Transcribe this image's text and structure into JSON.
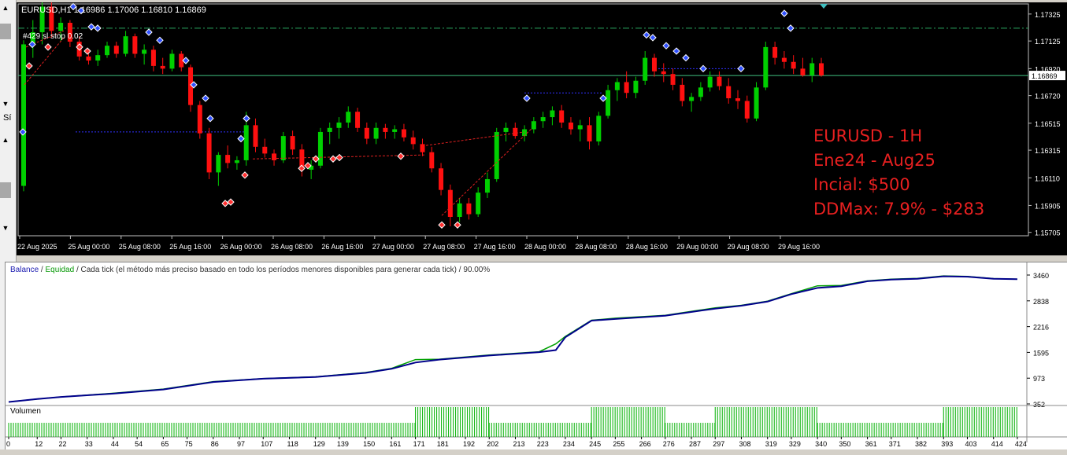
{
  "left_strip": {
    "text_1": "Sí"
  },
  "chart": {
    "symbol_header": "EURUSD,H1  1.16986 1.17006 1.16810 1.16869",
    "trade_label": "#429 sl stop 0.02",
    "current_price": "1.16869",
    "price_ticks": [
      "1.17325",
      "1.17125",
      "1.16920",
      "1.16720",
      "1.16515",
      "1.16315",
      "1.16110",
      "1.15905",
      "1.15705"
    ],
    "time_ticks": [
      "22 Aug 2025",
      "25 Aug 00:00",
      "25 Aug 08:00",
      "25 Aug 16:00",
      "26 Aug 00:00",
      "26 Aug 08:00",
      "26 Aug 16:00",
      "27 Aug 00:00",
      "27 Aug 08:00",
      "27 Aug 16:00",
      "28 Aug 00:00",
      "28 Aug 08:00",
      "28 Aug 16:00",
      "29 Aug 00:00",
      "29 Aug 08:00",
      "29 Aug 16:00"
    ],
    "colors": {
      "bull": "#00d000",
      "bear": "#ff1010",
      "background": "#000000",
      "grid_line": "#40c080",
      "trade_line": "#3030ff"
    },
    "overlay": [
      "EURUSD - 1H",
      "Ene24 - Aug25",
      "Incial: $500",
      "DDMax: 7.9% - $283"
    ]
  },
  "tester": {
    "legend_balance": "Balance",
    "legend_equity": "Equidad",
    "mode_text": " / Cada tick (el método más preciso basado en todo los períodos menores disponibles para generar cada tick)  / 90.00%",
    "y_ticks": [
      "3460",
      "2838",
      "2216",
      "1595",
      "973",
      "352"
    ],
    "volume_label": "Volumen",
    "x_ticks": [
      "0",
      "12",
      "22",
      "33",
      "44",
      "54",
      "65",
      "75",
      "86",
      "97",
      "107",
      "118",
      "129",
      "139",
      "150",
      "161",
      "171",
      "181",
      "192",
      "202",
      "213",
      "223",
      "234",
      "245",
      "255",
      "266",
      "276",
      "287",
      "297",
      "308",
      "319",
      "329",
      "340",
      "350",
      "361",
      "371",
      "382",
      "393",
      "403",
      "414",
      "424"
    ],
    "colors": {
      "balance": "#00008b",
      "equity": "#00a000",
      "volume": "#00b000"
    }
  },
  "chart_data": [
    {
      "type": "candlestick",
      "title": "EURUSD,H1",
      "ylim": [
        1.1568,
        1.174
      ],
      "candles": [
        [
          1.1605,
          1.1713,
          1.1601,
          1.171
        ],
        [
          1.171,
          1.1728,
          1.17,
          1.1719
        ],
        [
          1.1719,
          1.1745,
          1.171,
          1.1738
        ],
        [
          1.1738,
          1.1742,
          1.1715,
          1.172
        ],
        [
          1.172,
          1.173,
          1.1712,
          1.1726
        ],
        [
          1.1726,
          1.1728,
          1.1708,
          1.1712
        ],
        [
          1.1712,
          1.1716,
          1.1698,
          1.1701
        ],
        [
          1.1701,
          1.1705,
          1.1695,
          1.1698
        ],
        [
          1.1698,
          1.1706,
          1.1694,
          1.1702
        ],
        [
          1.1702,
          1.1712,
          1.17,
          1.1709
        ],
        [
          1.1709,
          1.1712,
          1.17,
          1.1703
        ],
        [
          1.1703,
          1.172,
          1.1701,
          1.1716
        ],
        [
          1.1716,
          1.1718,
          1.17,
          1.1703
        ],
        [
          1.1703,
          1.171,
          1.1695,
          1.1706
        ],
        [
          1.1706,
          1.1709,
          1.169,
          1.1694
        ],
        [
          1.1694,
          1.17,
          1.1688,
          1.1692
        ],
        [
          1.1692,
          1.1706,
          1.169,
          1.1703
        ],
        [
          1.1703,
          1.1705,
          1.169,
          1.1693
        ],
        [
          1.1693,
          1.1695,
          1.166,
          1.1665
        ],
        [
          1.1665,
          1.1668,
          1.164,
          1.1644
        ],
        [
          1.1644,
          1.1648,
          1.161,
          1.1615
        ],
        [
          1.1615,
          1.163,
          1.1605,
          1.1628
        ],
        [
          1.1628,
          1.1635,
          1.1618,
          1.1622
        ],
        [
          1.1622,
          1.1627,
          1.1617,
          1.1624
        ],
        [
          1.1624,
          1.166,
          1.162,
          1.165
        ],
        [
          1.165,
          1.1655,
          1.163,
          1.1634
        ],
        [
          1.1634,
          1.164,
          1.1626,
          1.1629
        ],
        [
          1.1629,
          1.1632,
          1.162,
          1.1624
        ],
        [
          1.1624,
          1.1645,
          1.1622,
          1.1642
        ],
        [
          1.1642,
          1.1646,
          1.1628,
          1.1632
        ],
        [
          1.1632,
          1.1636,
          1.1612,
          1.1617
        ],
        [
          1.1617,
          1.1624,
          1.161,
          1.162
        ],
        [
          1.162,
          1.1648,
          1.1618,
          1.1645
        ],
        [
          1.1645,
          1.1652,
          1.1636,
          1.1648
        ],
        [
          1.1648,
          1.1656,
          1.164,
          1.1652
        ],
        [
          1.1652,
          1.1664,
          1.1648,
          1.166
        ],
        [
          1.166,
          1.1663,
          1.1645,
          1.1648
        ],
        [
          1.1648,
          1.1652,
          1.1636,
          1.164
        ],
        [
          1.164,
          1.1652,
          1.1636,
          1.1648
        ],
        [
          1.1648,
          1.1651,
          1.164,
          1.1645
        ],
        [
          1.1645,
          1.165,
          1.164,
          1.1647
        ],
        [
          1.1647,
          1.1651,
          1.1638,
          1.1641
        ],
        [
          1.1641,
          1.1646,
          1.1632,
          1.1636
        ],
        [
          1.1636,
          1.164,
          1.1627,
          1.163
        ],
        [
          1.163,
          1.1634,
          1.1615,
          1.1618
        ],
        [
          1.1618,
          1.1622,
          1.1598,
          1.1602
        ],
        [
          1.1602,
          1.1606,
          1.1575,
          1.1582
        ],
        [
          1.1582,
          1.1596,
          1.1578,
          1.1592
        ],
        [
          1.1592,
          1.1596,
          1.158,
          1.1584
        ],
        [
          1.1584,
          1.1604,
          1.1582,
          1.16
        ],
        [
          1.16,
          1.1615,
          1.1596,
          1.161
        ],
        [
          1.161,
          1.1648,
          1.1608,
          1.1645
        ],
        [
          1.1645,
          1.1652,
          1.1638,
          1.1648
        ],
        [
          1.1648,
          1.1652,
          1.164,
          1.1642
        ],
        [
          1.1642,
          1.165,
          1.1638,
          1.1647
        ],
        [
          1.1647,
          1.1656,
          1.1644,
          1.1653
        ],
        [
          1.1653,
          1.166,
          1.1648,
          1.1656
        ],
        [
          1.1656,
          1.1664,
          1.165,
          1.1661
        ],
        [
          1.1661,
          1.1665,
          1.1648,
          1.1652
        ],
        [
          1.1652,
          1.1656,
          1.1643,
          1.1647
        ],
        [
          1.1647,
          1.1654,
          1.1638,
          1.165
        ],
        [
          1.165,
          1.1656,
          1.1632,
          1.1638
        ],
        [
          1.1638,
          1.166,
          1.1635,
          1.1657
        ],
        [
          1.1657,
          1.168,
          1.1655,
          1.1676
        ],
        [
          1.1676,
          1.1685,
          1.1668,
          1.1682
        ],
        [
          1.1682,
          1.169,
          1.167,
          1.1674
        ],
        [
          1.1674,
          1.1686,
          1.167,
          1.1683
        ],
        [
          1.1683,
          1.1705,
          1.168,
          1.17
        ],
        [
          1.17,
          1.1703,
          1.1686,
          1.169
        ],
        [
          1.169,
          1.1696,
          1.1682,
          1.1688
        ],
        [
          1.1688,
          1.1692,
          1.1676,
          1.168
        ],
        [
          1.168,
          1.1685,
          1.1664,
          1.1668
        ],
        [
          1.1668,
          1.1674,
          1.166,
          1.1671
        ],
        [
          1.1671,
          1.1682,
          1.1668,
          1.1678
        ],
        [
          1.1678,
          1.169,
          1.1675,
          1.1686
        ],
        [
          1.1686,
          1.169,
          1.1676,
          1.1679
        ],
        [
          1.1679,
          1.1685,
          1.1666,
          1.167
        ],
        [
          1.167,
          1.1676,
          1.1662,
          1.1668
        ],
        [
          1.1668,
          1.1672,
          1.1652,
          1.1655
        ],
        [
          1.1655,
          1.1682,
          1.1653,
          1.1678
        ],
        [
          1.1678,
          1.1712,
          1.1676,
          1.1708
        ],
        [
          1.1708,
          1.1712,
          1.1695,
          1.17
        ],
        [
          1.17,
          1.1705,
          1.1692,
          1.1697
        ],
        [
          1.1697,
          1.1702,
          1.1688,
          1.1692
        ],
        [
          1.1692,
          1.17,
          1.1686,
          1.1687
        ],
        [
          1.1687,
          1.17,
          1.1682,
          1.1696
        ],
        [
          1.1696,
          1.17,
          1.1686,
          1.16869
        ]
      ]
    },
    {
      "type": "line",
      "title": "Balance / Equidad",
      "ylim": [
        352,
        3460
      ],
      "series": [
        {
          "name": "Balance",
          "x": [
            0,
            12,
            22,
            44,
            65,
            86,
            107,
            129,
            150,
            161,
            171,
            181,
            202,
            223,
            230,
            234,
            245,
            255,
            276,
            297,
            308,
            319,
            329,
            340,
            350,
            361,
            371,
            382,
            393,
            403,
            414,
            424
          ],
          "values": [
            400,
            470,
            520,
            600,
            700,
            880,
            960,
            1000,
            1100,
            1200,
            1350,
            1420,
            1520,
            1600,
            1650,
            1960,
            2360,
            2400,
            2480,
            2650,
            2720,
            2820,
            3000,
            3150,
            3190,
            3310,
            3350,
            3370,
            3430,
            3420,
            3370,
            3360
          ]
        },
        {
          "name": "Equidad",
          "x": [
            0,
            12,
            22,
            44,
            65,
            86,
            107,
            129,
            150,
            161,
            171,
            181,
            202,
            223,
            230,
            234,
            245,
            255,
            276,
            297,
            308,
            319,
            329,
            340,
            350,
            361,
            371,
            382,
            393,
            403,
            414,
            424
          ],
          "values": [
            400,
            470,
            520,
            610,
            710,
            890,
            965,
            1005,
            1110,
            1210,
            1420,
            1430,
            1530,
            1610,
            1800,
            1980,
            2370,
            2420,
            2490,
            2670,
            2730,
            2830,
            3010,
            3200,
            3210,
            3320,
            3360,
            3380,
            3440,
            3425,
            3375,
            3360
          ]
        }
      ]
    },
    {
      "type": "bar",
      "title": "Volumen",
      "x": [
        0,
        171,
        202,
        245,
        276,
        297,
        340,
        393,
        424
      ],
      "values": [
        1,
        2,
        1,
        2,
        1,
        2,
        1,
        2,
        2
      ]
    }
  ]
}
